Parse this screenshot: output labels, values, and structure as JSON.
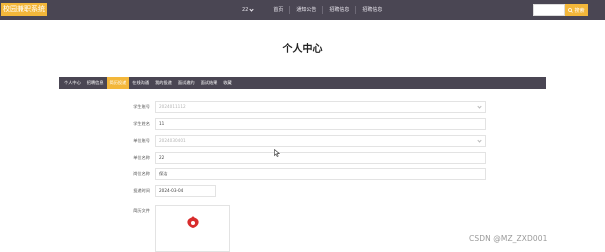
{
  "app": {
    "logo_text": "校园兼职系统"
  },
  "nav": {
    "user": "22",
    "items": [
      "首页",
      "通知公告",
      "招聘信息",
      "招聘信息"
    ]
  },
  "search": {
    "button_label": "搜索"
  },
  "page": {
    "title": "个人中心"
  },
  "tabs": [
    "个人中心",
    "招聘信息",
    "简历投递",
    "在线沟通",
    "我的投递",
    "面试邀约",
    "面试结果",
    "收藏"
  ],
  "form": {
    "rows": [
      {
        "label": "学生账号",
        "value": "2024011112",
        "kind": "select"
      },
      {
        "label": "学生姓名",
        "value": "11",
        "kind": "text"
      },
      {
        "label": "单位账号",
        "value": "2024030401",
        "kind": "select"
      },
      {
        "label": "单位名称",
        "value": "22",
        "kind": "text"
      },
      {
        "label": "岗位名称",
        "value": "保洁",
        "kind": "text"
      },
      {
        "label": "投递时间",
        "value": "2024-03-04",
        "kind": "date"
      },
      {
        "label": "简历文件",
        "value": "",
        "kind": "file"
      }
    ]
  },
  "watermark": "CSDN @MZ_ZXD001",
  "colors": {
    "nav_bg": "#4a4653",
    "accent": "#f3b73a"
  }
}
